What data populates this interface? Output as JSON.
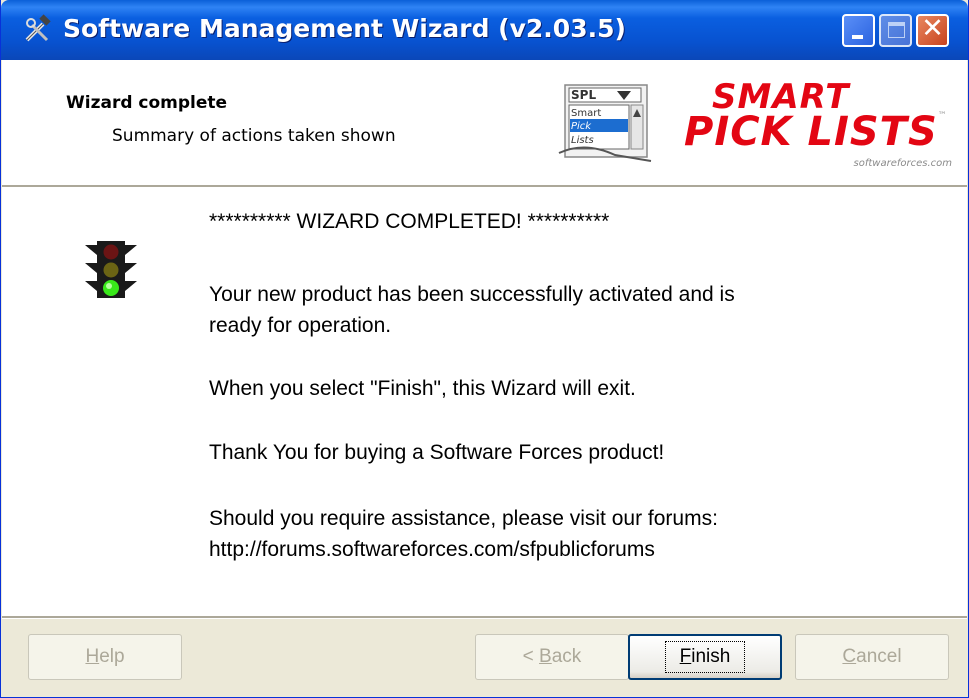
{
  "window": {
    "title": "Software Management Wizard (v2.03.5)",
    "icon": "tools-icon",
    "controls": [
      "minimize-icon",
      "maximize-icon",
      "close-icon"
    ]
  },
  "header": {
    "title": "Wizard complete",
    "subtitle": "Summary of actions taken shown",
    "logo": {
      "box_title": "SPL",
      "box_lines": [
        "Smart",
        "Pick",
        "Lists"
      ],
      "brand_line1": "SMART",
      "brand_line2": "PICK LISTS",
      "trademark": "™",
      "domain": "softwareforces.com"
    }
  },
  "content": {
    "status_icon": "traffic-light-green-icon",
    "heading": "********** WIZARD COMPLETED! **********",
    "paragraphs": [
      "Your new product has been successfully activated and is",
      "ready for operation.",
      "When you select \"Finish\", this Wizard will exit.",
      "Thank You for buying a Software Forces product!",
      "Should you require assistance, please visit our forums:",
      "http://forums.softwareforces.com/sfpublicforums"
    ]
  },
  "buttons": {
    "help": {
      "mnemonic": "H",
      "rest": "elp",
      "enabled": false
    },
    "back": {
      "prefix": "< ",
      "mnemonic": "B",
      "rest": "ack",
      "enabled": false
    },
    "finish": {
      "mnemonic": "F",
      "rest": "inish",
      "enabled": true
    },
    "cancel": {
      "mnemonic": "C",
      "rest": "ancel",
      "enabled": false
    }
  },
  "colors": {
    "titlebar": "#0a5fd8",
    "brand_red": "#e30613",
    "dialog_face": "#ece9d8",
    "disabled_text": "#aca899"
  }
}
